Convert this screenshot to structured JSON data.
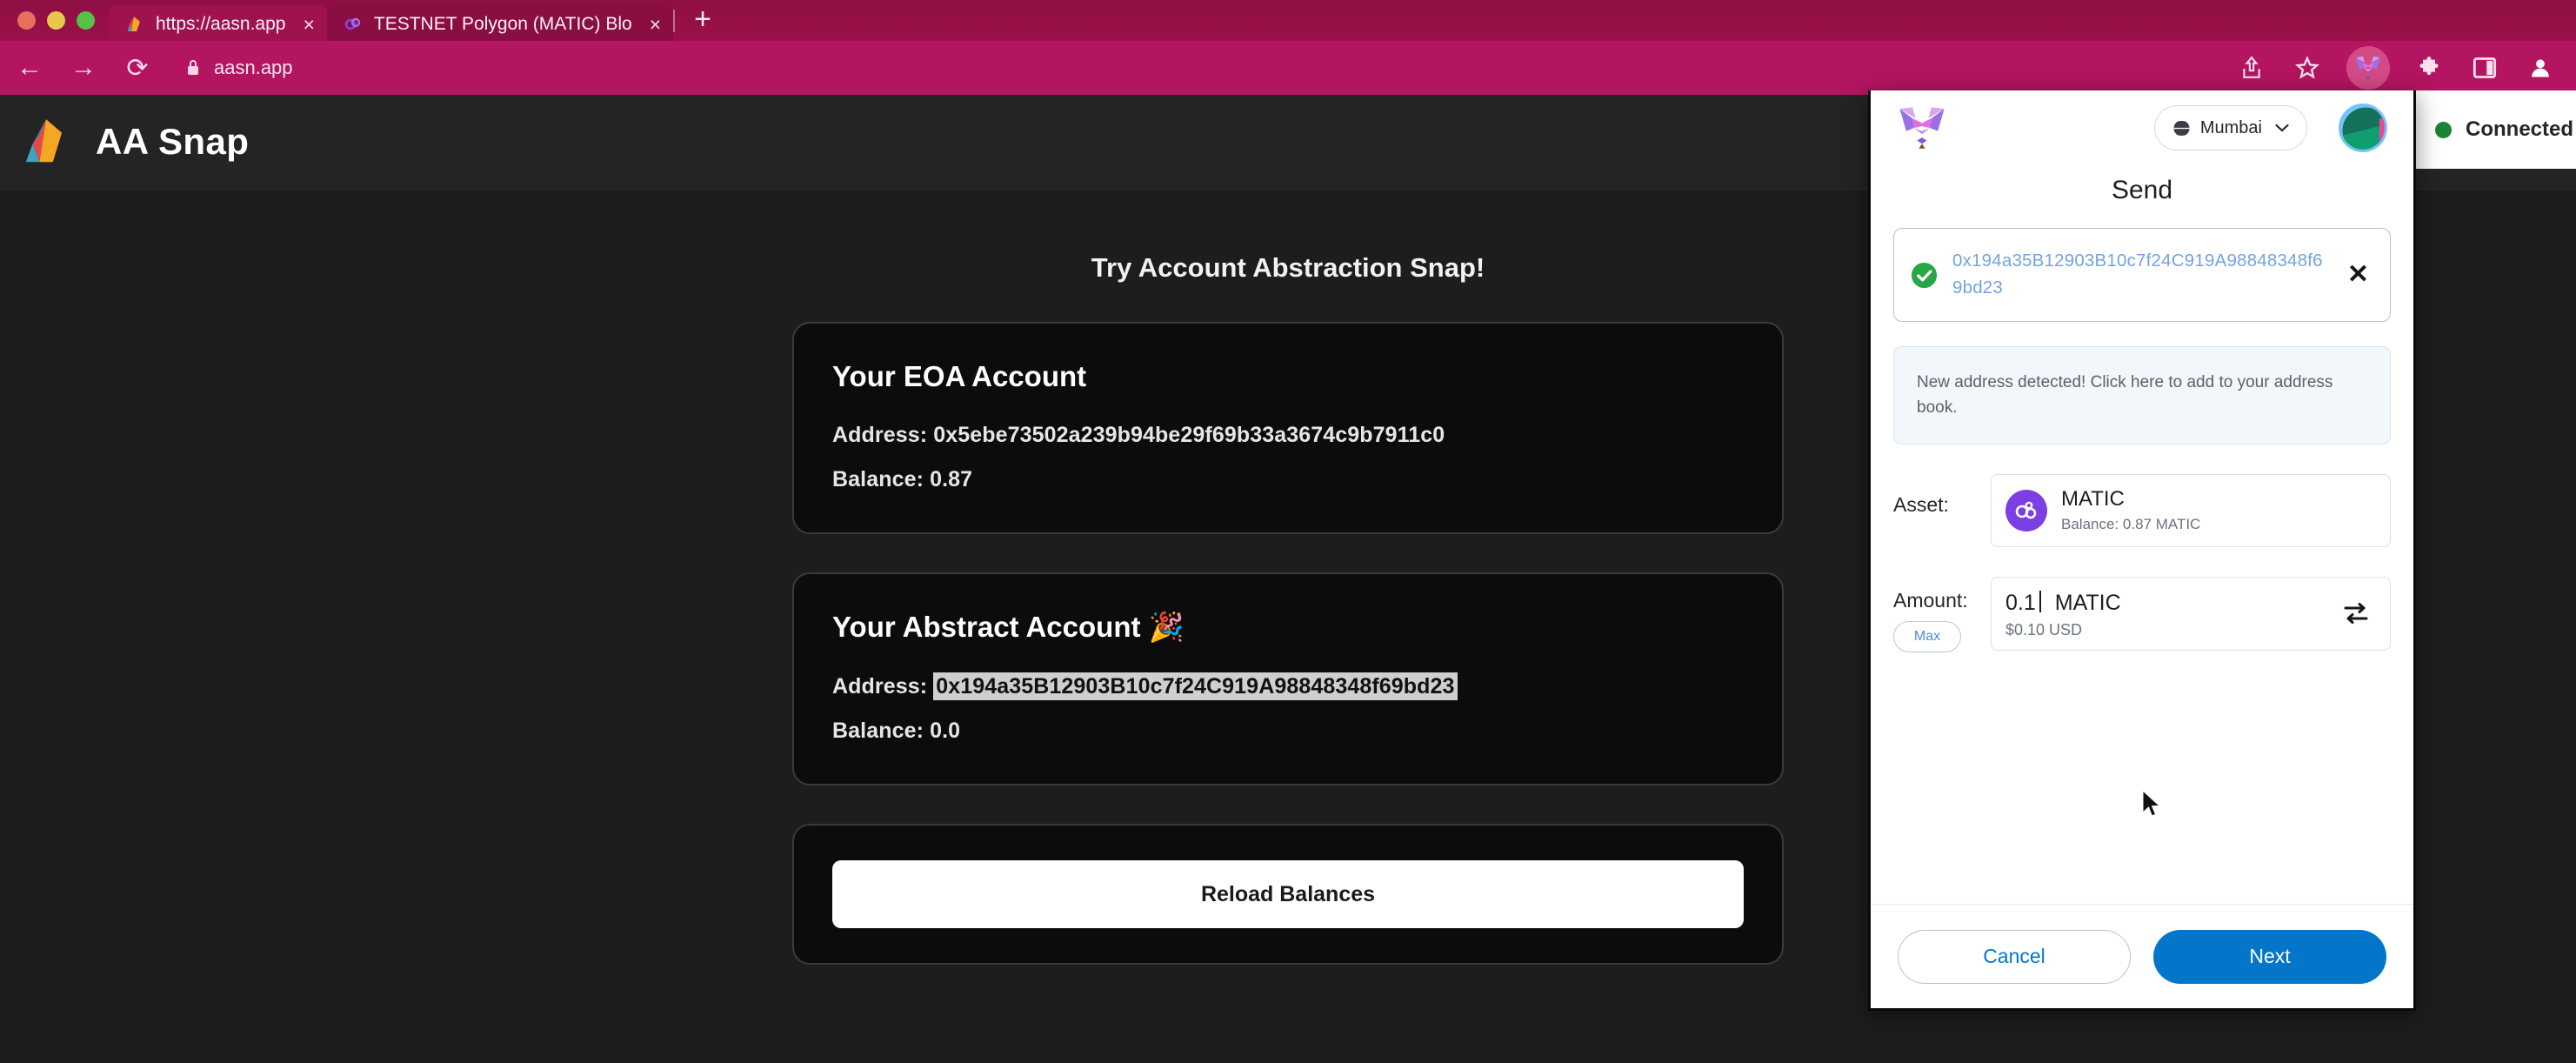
{
  "browser": {
    "traffic_lights": [
      "close",
      "minimize",
      "maximize"
    ],
    "tabs": [
      {
        "title": "https://aasn.app",
        "favicon": "aa-snap-icon",
        "close_label": "×",
        "active": true
      },
      {
        "title": "TESTNET Polygon (MATIC) Blo",
        "favicon": "polygonscan-icon",
        "close_label": "×",
        "active": false
      }
    ],
    "new_tab_label": "+",
    "nav": {
      "back": "←",
      "forward": "→",
      "reload": "⟳"
    },
    "url": "aasn.app",
    "lock_icon": "lock-icon",
    "toolbar_icons": [
      "share-icon",
      "bookmark-star-icon",
      "metamask-fox-icon",
      "extensions-puzzle-icon",
      "side-panel-icon",
      "profile-avatar-icon"
    ]
  },
  "site": {
    "brand": "AA Snap",
    "heading": "Try Account Abstraction Snap!",
    "eoa_card": {
      "title": "Your EOA Account",
      "address_label": "Address:",
      "address": "0x5ebe73502a239b94be29f69b33a3674c9b7911c0",
      "balance_label": "Balance:",
      "balance": "0.87"
    },
    "aa_card": {
      "title": "Your Abstract Account 🎉",
      "address_label": "Address:",
      "address": "0x194a35B12903B10c7f24C919A98848348f69bd23",
      "balance_label": "Balance:",
      "balance": "0.0"
    },
    "reload_button": "Reload Balances"
  },
  "metamask": {
    "network": "Mumbai",
    "title": "Send",
    "recipient": {
      "address": "0x194a35B12903B10c7f24C919A98848348f69bd23",
      "valid_icon": "check-circle-icon",
      "clear_label": "✕"
    },
    "notice": "New address detected! Click here to add to your address book.",
    "asset": {
      "label": "Asset:",
      "name": "MATIC",
      "balance_label": "Balance:",
      "balance": "0.87 MATIC"
    },
    "amount": {
      "label": "Amount:",
      "max_label": "Max",
      "value": "0.1",
      "unit": "MATIC",
      "fiat": "$0.10 USD",
      "swap_icon": "swap-currency-icon"
    },
    "cancel_label": "Cancel",
    "next_label": "Next"
  },
  "connection": {
    "status": "Connected",
    "dot_color": "#1c8234"
  },
  "colors": {
    "chrome_tabstrip": "#8e0f44",
    "chrome_toolbar": "#b31560",
    "page_bg": "#1d1d1d",
    "card_bg": "#0c0c0c",
    "accent_blue": "#0376c9",
    "matic_purple": "#7b3fe4",
    "success_green": "#1c8234"
  }
}
